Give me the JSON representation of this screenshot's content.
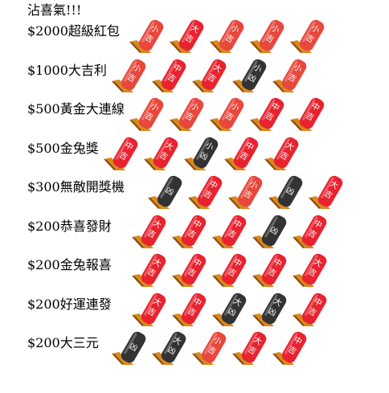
{
  "page_title": "沾喜氣!!!",
  "colors": {
    "red_stick": "#e8232f",
    "coral_stick": "#e8473c",
    "black_stick": "#333333",
    "hand": "#d8891e",
    "hand_dark": "#8b4a0e"
  },
  "rows": [
    {
      "label": "$2000超級紅包",
      "sticks": [
        {
          "text": "小吉",
          "color": "coral"
        },
        {
          "text": "大吉",
          "color": "red"
        },
        {
          "text": "小吉",
          "color": "coral"
        },
        {
          "text": "小吉",
          "color": "coral"
        },
        {
          "text": "小吉",
          "color": "coral"
        }
      ]
    },
    {
      "label": "$1000大吉利",
      "sticks": [
        {
          "text": "小吉",
          "color": "coral"
        },
        {
          "text": "中吉",
          "color": "red"
        },
        {
          "text": "大吉",
          "color": "red"
        },
        {
          "text": "小凶",
          "color": "black"
        },
        {
          "text": "小吉",
          "color": "coral"
        }
      ]
    },
    {
      "label": "$500黃金大連線",
      "sticks": [
        {
          "text": "小吉",
          "color": "coral"
        },
        {
          "text": "小吉",
          "color": "coral"
        },
        {
          "text": "小吉",
          "color": "coral"
        },
        {
          "text": "中吉",
          "color": "red"
        },
        {
          "text": "中吉",
          "color": "red"
        }
      ]
    },
    {
      "label": "$500金兔獎",
      "sticks": [
        {
          "text": "中吉",
          "color": "red"
        },
        {
          "text": "大吉",
          "color": "red"
        },
        {
          "text": "小凶",
          "color": "black"
        },
        {
          "text": "中吉",
          "color": "red"
        },
        {
          "text": "大吉",
          "color": "red"
        }
      ]
    },
    {
      "label": "$300無敵開獎機",
      "sticks": [
        {
          "text": "凶",
          "color": "black"
        },
        {
          "text": "中吉",
          "color": "red"
        },
        {
          "text": "小吉",
          "color": "coral"
        },
        {
          "text": "凶",
          "color": "black"
        },
        {
          "text": "大吉",
          "color": "red"
        }
      ]
    },
    {
      "label": "$200恭喜發財",
      "sticks": [
        {
          "text": "大吉",
          "color": "red"
        },
        {
          "text": "中吉",
          "color": "red"
        },
        {
          "text": "中吉",
          "color": "red"
        },
        {
          "text": "凶",
          "color": "black"
        },
        {
          "text": "中吉",
          "color": "red"
        }
      ]
    },
    {
      "label": "$200金兔報喜",
      "sticks": [
        {
          "text": "大吉",
          "color": "red"
        },
        {
          "text": "中吉",
          "color": "red"
        },
        {
          "text": "中吉",
          "color": "red"
        },
        {
          "text": "中吉",
          "color": "red"
        },
        {
          "text": "大吉",
          "color": "red"
        }
      ]
    },
    {
      "label": "$200好運連發",
      "sticks": [
        {
          "text": "大吉",
          "color": "red"
        },
        {
          "text": "中吉",
          "color": "red"
        },
        {
          "text": "大凶",
          "color": "black"
        },
        {
          "text": "大凶",
          "color": "black"
        },
        {
          "text": "中吉",
          "color": "red"
        }
      ]
    },
    {
      "label": "$200大三元",
      "sticks": [
        {
          "text": "凶",
          "color": "black"
        },
        {
          "text": "大凶",
          "color": "black"
        },
        {
          "text": "小吉",
          "color": "coral"
        },
        {
          "text": "大吉",
          "color": "red"
        },
        {
          "text": "中吉",
          "color": "red"
        }
      ]
    }
  ]
}
